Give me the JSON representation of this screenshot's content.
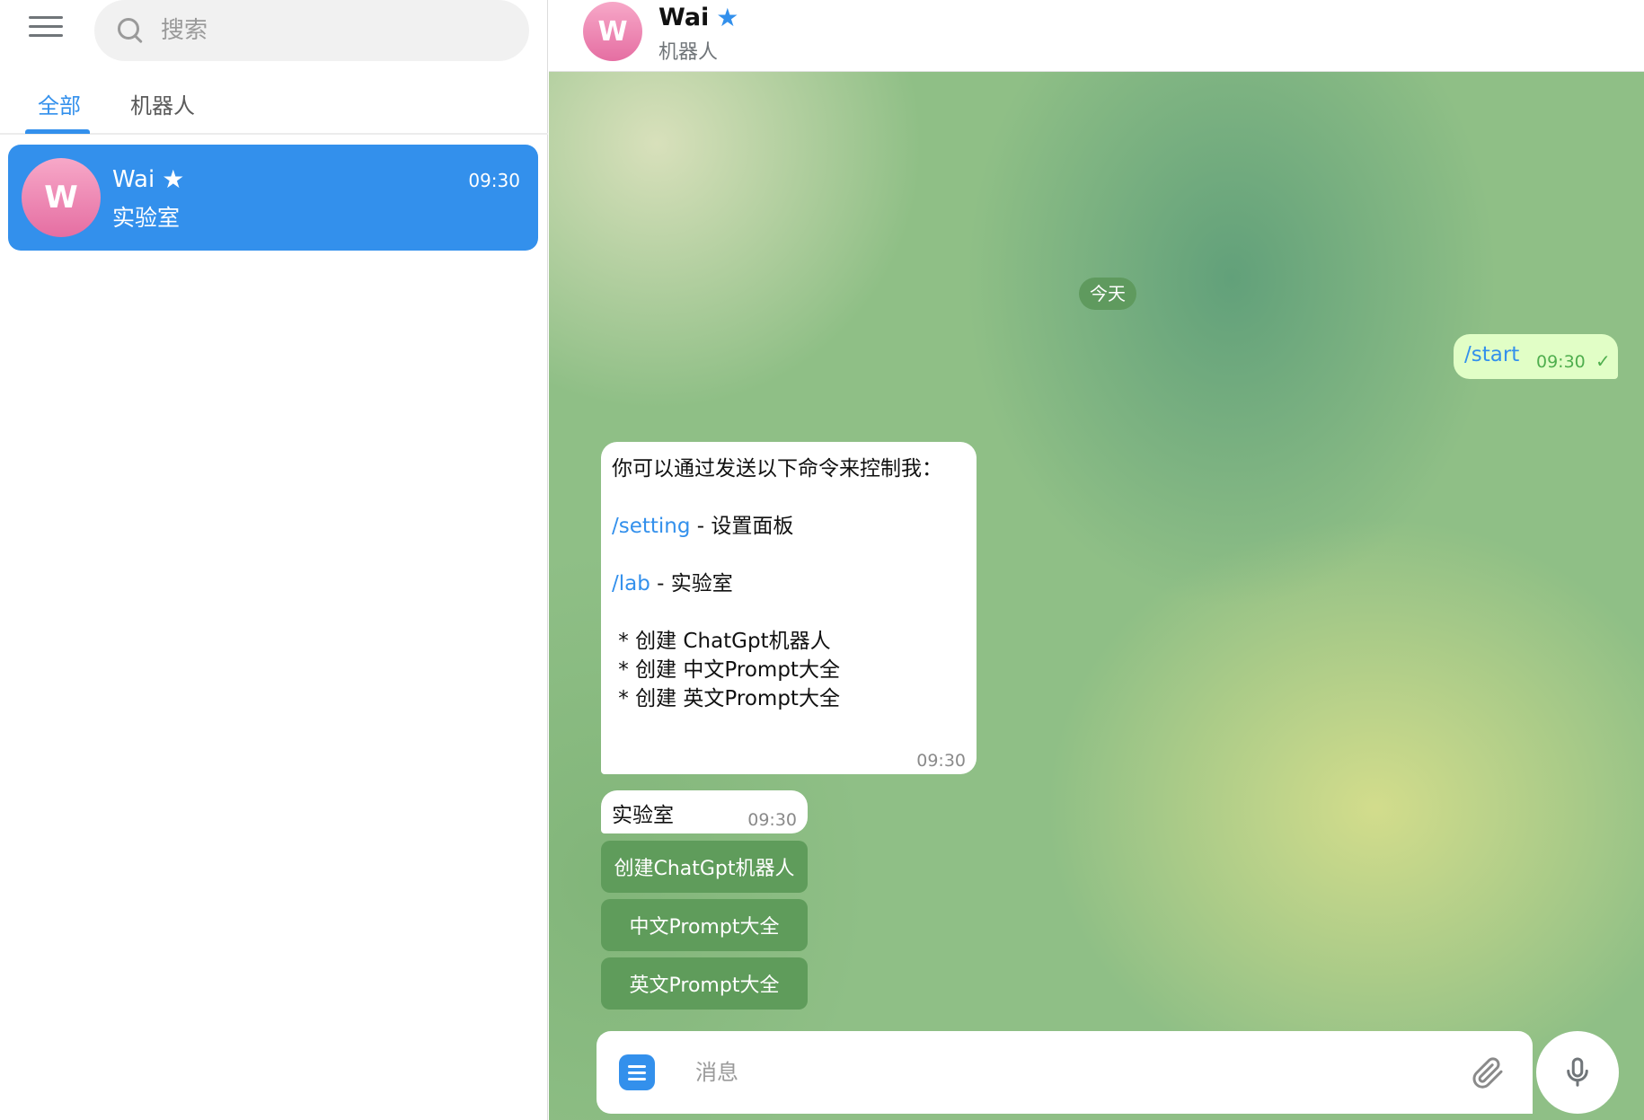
{
  "sidebar": {
    "search": {
      "placeholder": "搜索"
    },
    "tabs": [
      {
        "label": "全部",
        "active": true
      },
      {
        "label": "机器人",
        "active": false
      }
    ],
    "chats": [
      {
        "avatar_letter": "W",
        "name": "Wai",
        "preview": "实验室",
        "time": "09:30",
        "selected": true,
        "icon": "star-icon"
      }
    ]
  },
  "header": {
    "avatar_letter": "W",
    "name": "Wai",
    "subtitle": "机器人",
    "icon": "star-icon"
  },
  "messages": {
    "date_label": "今天",
    "outgoing": {
      "text": "/start",
      "time": "09:30",
      "status_icon": "check-icon"
    },
    "help": {
      "intro": "你可以通过发送以下命令来控制我：",
      "setting_cmd": "/setting",
      "setting_desc": " - 设置面板",
      "lab_cmd": "/lab",
      "lab_desc": " - 实验室",
      "bullets": [
        " * 创建 ChatGpt机器人",
        " * 创建 中文Prompt大全",
        " * 创建 英文Prompt大全"
      ],
      "time": "09:30"
    },
    "lab": {
      "text": "实验室",
      "time": "09:30",
      "buttons": [
        "创建ChatGpt机器人",
        "中文Prompt大全",
        "英文Prompt大全"
      ]
    }
  },
  "composer": {
    "placeholder": "消息",
    "menu_icon": "bot-menu-icon",
    "attach_icon": "paperclip-icon",
    "mic_icon": "microphone-icon"
  },
  "colors": {
    "accent": "#3390ec",
    "outgoing_bubble": "#e1fec6",
    "keyboard_button": "#5f9c5b"
  }
}
